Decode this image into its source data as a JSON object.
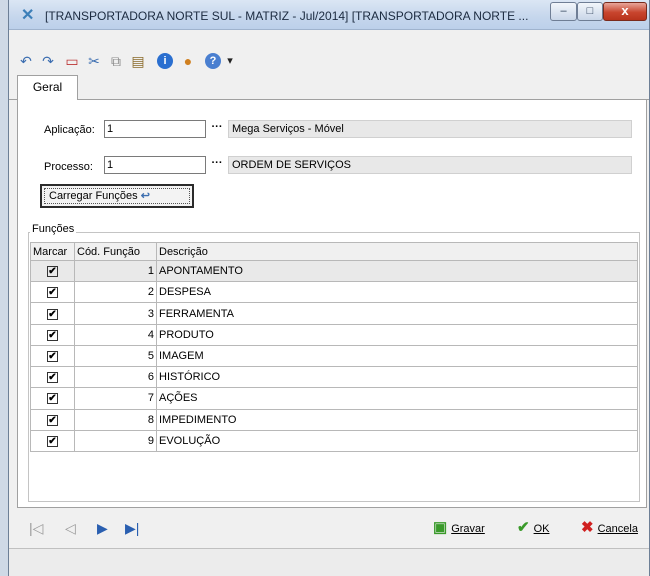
{
  "window": {
    "title": "[TRANSPORTADORA NORTE SUL -  MATRIZ - Jul/2014] [TRANSPORTADORA NORTE ...",
    "minimize": "–",
    "maximize": "□",
    "close": "x"
  },
  "toolbar": {
    "icons": [
      "undo-icon",
      "redo-icon",
      "new-document-icon",
      "cut-icon",
      "copy-icon",
      "paste-icon",
      "info-icon",
      "user-icon",
      "help-icon",
      "dropdown-arrow-icon"
    ],
    "undo": "↶",
    "redo": "↷",
    "new": "▭",
    "cut": "✂",
    "copy": "⧉",
    "paste": "▤",
    "info": "i",
    "user": "●",
    "help": "?",
    "dropdown": "▾"
  },
  "tabs": {
    "geral": "Geral"
  },
  "form": {
    "aplicacao_label": "Aplicação:",
    "aplicacao_value": "1",
    "aplicacao_desc": "Mega Serviços - Móvel",
    "processo_label": "Processo:",
    "processo_value": "1",
    "processo_desc": "ORDEM DE SERVIÇOS",
    "ellipsis": "···",
    "load_button": "Carregar Funções",
    "load_icon": "↩"
  },
  "funcoes": {
    "group_label": "Funções",
    "columns": [
      "Marcar",
      "Cód. Função",
      "Descrição"
    ],
    "rows": [
      {
        "checked": "✔",
        "code": "1",
        "desc": "APONTAMENTO"
      },
      {
        "checked": "✔",
        "code": "2",
        "desc": "DESPESA"
      },
      {
        "checked": "✔",
        "code": "3",
        "desc": "FERRAMENTA"
      },
      {
        "checked": "✔",
        "code": "4",
        "desc": "PRODUTO"
      },
      {
        "checked": "✔",
        "code": "5",
        "desc": "IMAGEM"
      },
      {
        "checked": "✔",
        "code": "6",
        "desc": "HISTÓRICO"
      },
      {
        "checked": "✔",
        "code": "7",
        "desc": "AÇÕES"
      },
      {
        "checked": "✔",
        "code": "8",
        "desc": "IMPEDIMENTO"
      },
      {
        "checked": "✔",
        "code": "9",
        "desc": "EVOLUÇÃO"
      }
    ]
  },
  "footer": {
    "first": "|◁",
    "prev": "◁",
    "next": "▶",
    "last": "▶|",
    "gravar": "Gravar",
    "ok": "OK",
    "cancela": "Cancela",
    "gravar_icon": "▣",
    "ok_icon": "✔",
    "cancela_icon": "✖"
  },
  "colors": {
    "ok_green": "#3a9a2a",
    "cancel_red": "#d02020",
    "nav_blue": "#2a5fb0"
  }
}
